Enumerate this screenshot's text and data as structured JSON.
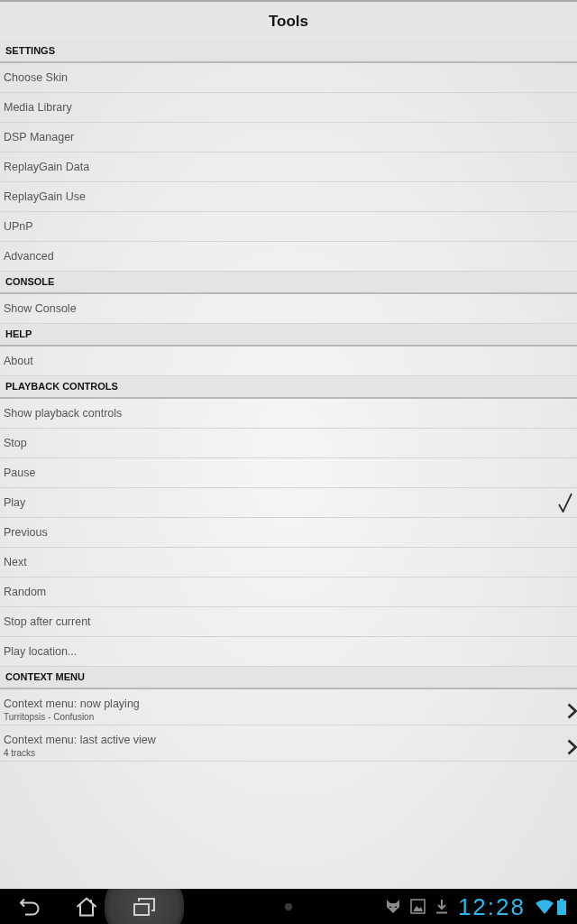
{
  "title": "Tools",
  "sections": [
    {
      "header": "SETTINGS",
      "items": [
        {
          "kind": "plain",
          "label": "Choose Skin"
        },
        {
          "kind": "plain",
          "label": "Media Library"
        },
        {
          "kind": "plain",
          "label": "DSP Manager"
        },
        {
          "kind": "plain",
          "label": "ReplayGain Data"
        },
        {
          "kind": "plain",
          "label": "ReplayGain Use"
        },
        {
          "kind": "plain",
          "label": "UPnP"
        },
        {
          "kind": "plain",
          "label": "Advanced"
        }
      ]
    },
    {
      "header": "CONSOLE",
      "items": [
        {
          "kind": "plain",
          "label": "Show Console"
        }
      ]
    },
    {
      "header": "HELP",
      "items": [
        {
          "kind": "plain",
          "label": "About"
        }
      ]
    },
    {
      "header": "PLAYBACK CONTROLS",
      "items": [
        {
          "kind": "checkable",
          "label": "Show playback controls",
          "checked": false
        },
        {
          "kind": "checkable",
          "label": "Stop",
          "checked": false
        },
        {
          "kind": "checkable",
          "label": "Pause",
          "checked": false
        },
        {
          "kind": "checkable",
          "label": "Play",
          "checked": true
        },
        {
          "kind": "checkable",
          "label": "Previous",
          "checked": false
        },
        {
          "kind": "checkable",
          "label": "Next",
          "checked": false
        },
        {
          "kind": "checkable",
          "label": "Random",
          "checked": false
        },
        {
          "kind": "checkable",
          "label": "Stop after current",
          "checked": false
        },
        {
          "kind": "checkable",
          "label": "Play location...",
          "checked": false
        }
      ]
    },
    {
      "header": "CONTEXT MENU",
      "items": [
        {
          "kind": "submenu",
          "label": "Context menu: now playing",
          "subtitle": "Turritopsis - Confusion"
        },
        {
          "kind": "submenu",
          "label": "Context menu: last active view",
          "subtitle": "4 tracks"
        }
      ]
    }
  ],
  "nav_bar": {
    "buttons": [
      {
        "pressed": false
      },
      {
        "pressed": false
      },
      {
        "pressed": true
      }
    ],
    "time": "12:28"
  }
}
